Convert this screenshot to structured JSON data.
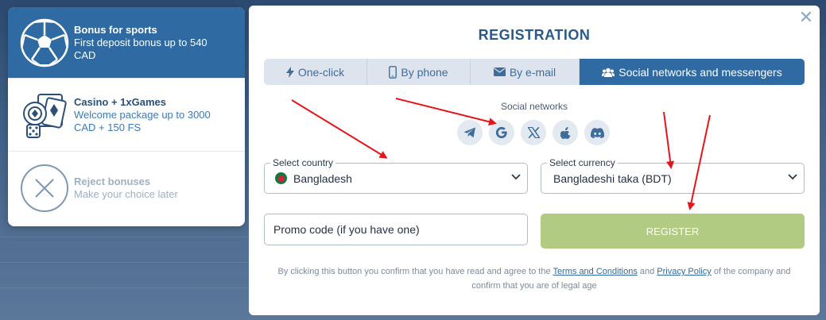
{
  "bonuses": [
    {
      "title": "Bonus for sports",
      "desc": "First deposit bonus up to 540 CAD",
      "icon": "soccer-ball-icon"
    },
    {
      "title": "Casino + 1xGames",
      "desc": "Welcome package up to 3000 CAD + 150 FS",
      "icon": "casino-chips-icon"
    },
    {
      "title": "Reject bonuses",
      "desc": "Make your choice later",
      "icon": "reject-x-icon"
    }
  ],
  "modal": {
    "title": "REGISTRATION",
    "close_icon": "close-icon",
    "tabs": [
      {
        "label": "One-click",
        "icon": "lightning-icon"
      },
      {
        "label": "By phone",
        "icon": "phone-icon"
      },
      {
        "label": "By e-mail",
        "icon": "envelope-icon"
      },
      {
        "label": "Social networks and messengers",
        "icon": "users-icon"
      }
    ],
    "active_tab": 3,
    "social_label": "Social networks",
    "social_icons": [
      "telegram-icon",
      "google-icon",
      "x-icon",
      "apple-icon",
      "discord-icon"
    ],
    "country": {
      "legend": "Select country",
      "value": "Bangladesh"
    },
    "currency": {
      "legend": "Select currency",
      "value": "Bangladeshi taka (BDT)"
    },
    "promo_placeholder": "Promo code (if you have one)",
    "register_label": "REGISTER",
    "legal": {
      "part1": "By clicking this button you confirm that you have read and agree to the ",
      "terms": "Terms and Conditions",
      "and": " and ",
      "privacy": "Privacy Policy",
      "part2": " of the company and confirm that you are of legal age"
    }
  },
  "colors": {
    "primary": "#2f6aa3",
    "register_button": "#b1cc82",
    "tab_inactive": "#dde4ee",
    "annotation_arrows": "#e8141c"
  }
}
